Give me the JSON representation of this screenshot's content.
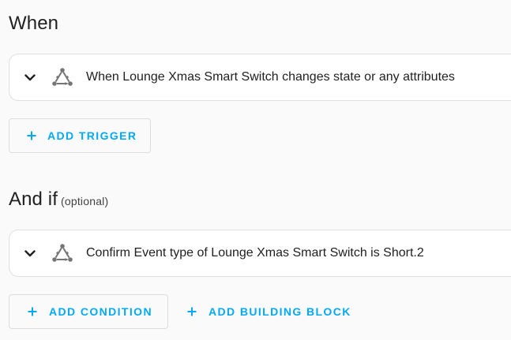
{
  "triggers": {
    "title": "When",
    "items": [
      {
        "label": "When Lounge Xmas Smart Switch changes state or any attributes",
        "icon": "state-trigger-icon"
      }
    ],
    "add_label": "ADD TRIGGER"
  },
  "conditions": {
    "title": "And if",
    "optional_label": "(optional)",
    "items": [
      {
        "label": "Confirm Event type of Lounge Xmas Smart Switch is Short.2",
        "icon": "state-condition-icon"
      }
    ],
    "add_label": "ADD CONDITION",
    "add_block_label": "ADD BUILDING BLOCK"
  },
  "colors": {
    "accent": "#03a9f4",
    "text": "#212121",
    "card_border": "#e0e0e0",
    "background": "#fafafa"
  }
}
